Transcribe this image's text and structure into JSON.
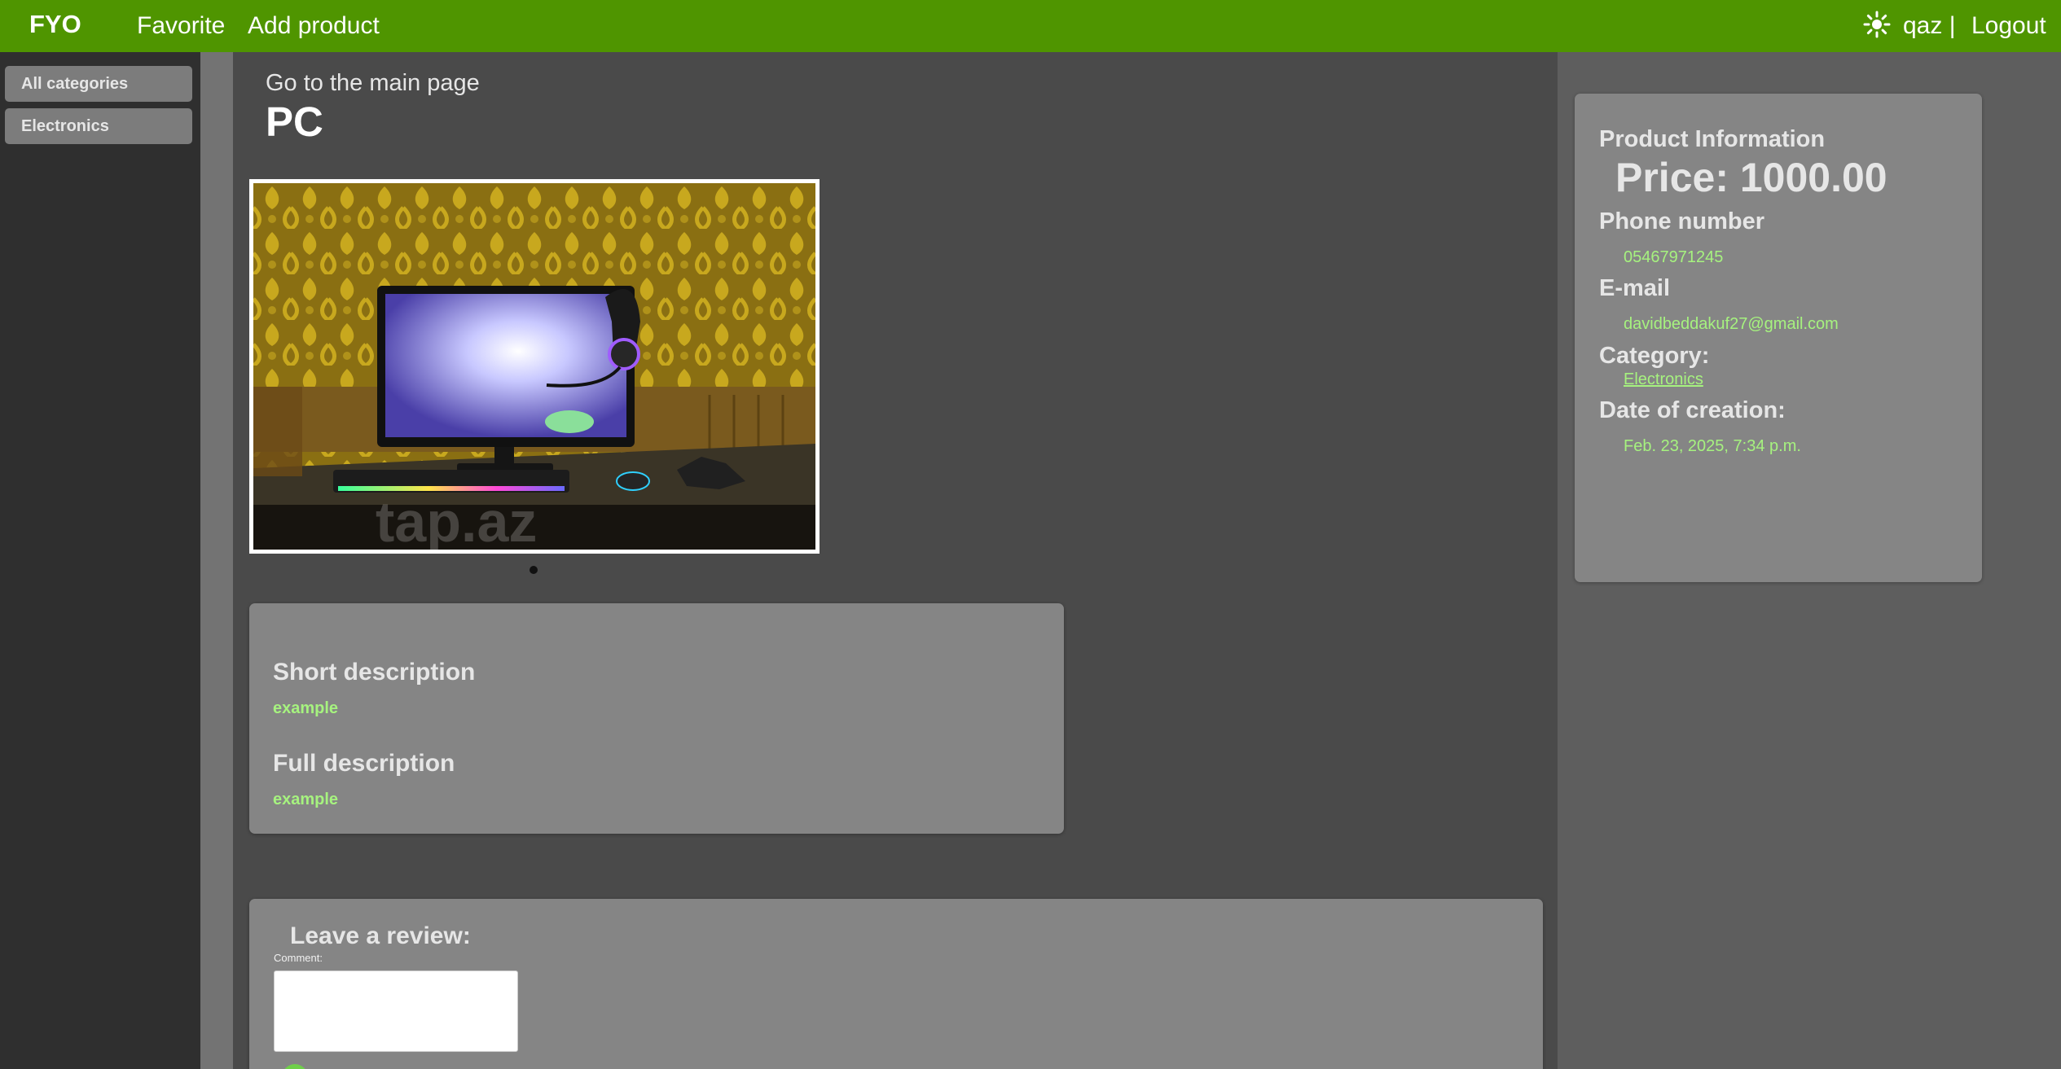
{
  "nav": {
    "brand": "FYO",
    "links": [
      "Favorite",
      "Add product"
    ],
    "theme_icon": "sun-icon",
    "user": "qaz |",
    "logout": "Logout"
  },
  "sidebar": {
    "items": [
      {
        "label": "All categories"
      },
      {
        "label": "Electronics"
      }
    ]
  },
  "main": {
    "back_link": "Go to the main page",
    "product_title": "PC",
    "carousel": {
      "slides": 1,
      "active": 1
    }
  },
  "description": {
    "short_heading": "Short description",
    "short_text": "example",
    "full_heading": "Full description",
    "full_text": "example"
  },
  "info": {
    "title": "Product Information",
    "price": "Price: 1000.00",
    "phone_label": "Phone number",
    "phone": "05467971245",
    "email_label": "E-mail",
    "email": "davidbeddakuf27@gmail.com",
    "category_label": "Category:",
    "category": "Electronics",
    "date_label": "Date of creation:",
    "date": "Feb. 23, 2025, 7:34 p.m."
  },
  "review": {
    "title": "Leave a review:",
    "comment_label": "Comment:",
    "comment_value": ""
  },
  "colors": {
    "nav_bg": "#4f9500",
    "page_bg": "#4a4a4a",
    "card_bg": "#858585",
    "accent_text": "#a6f27f"
  }
}
